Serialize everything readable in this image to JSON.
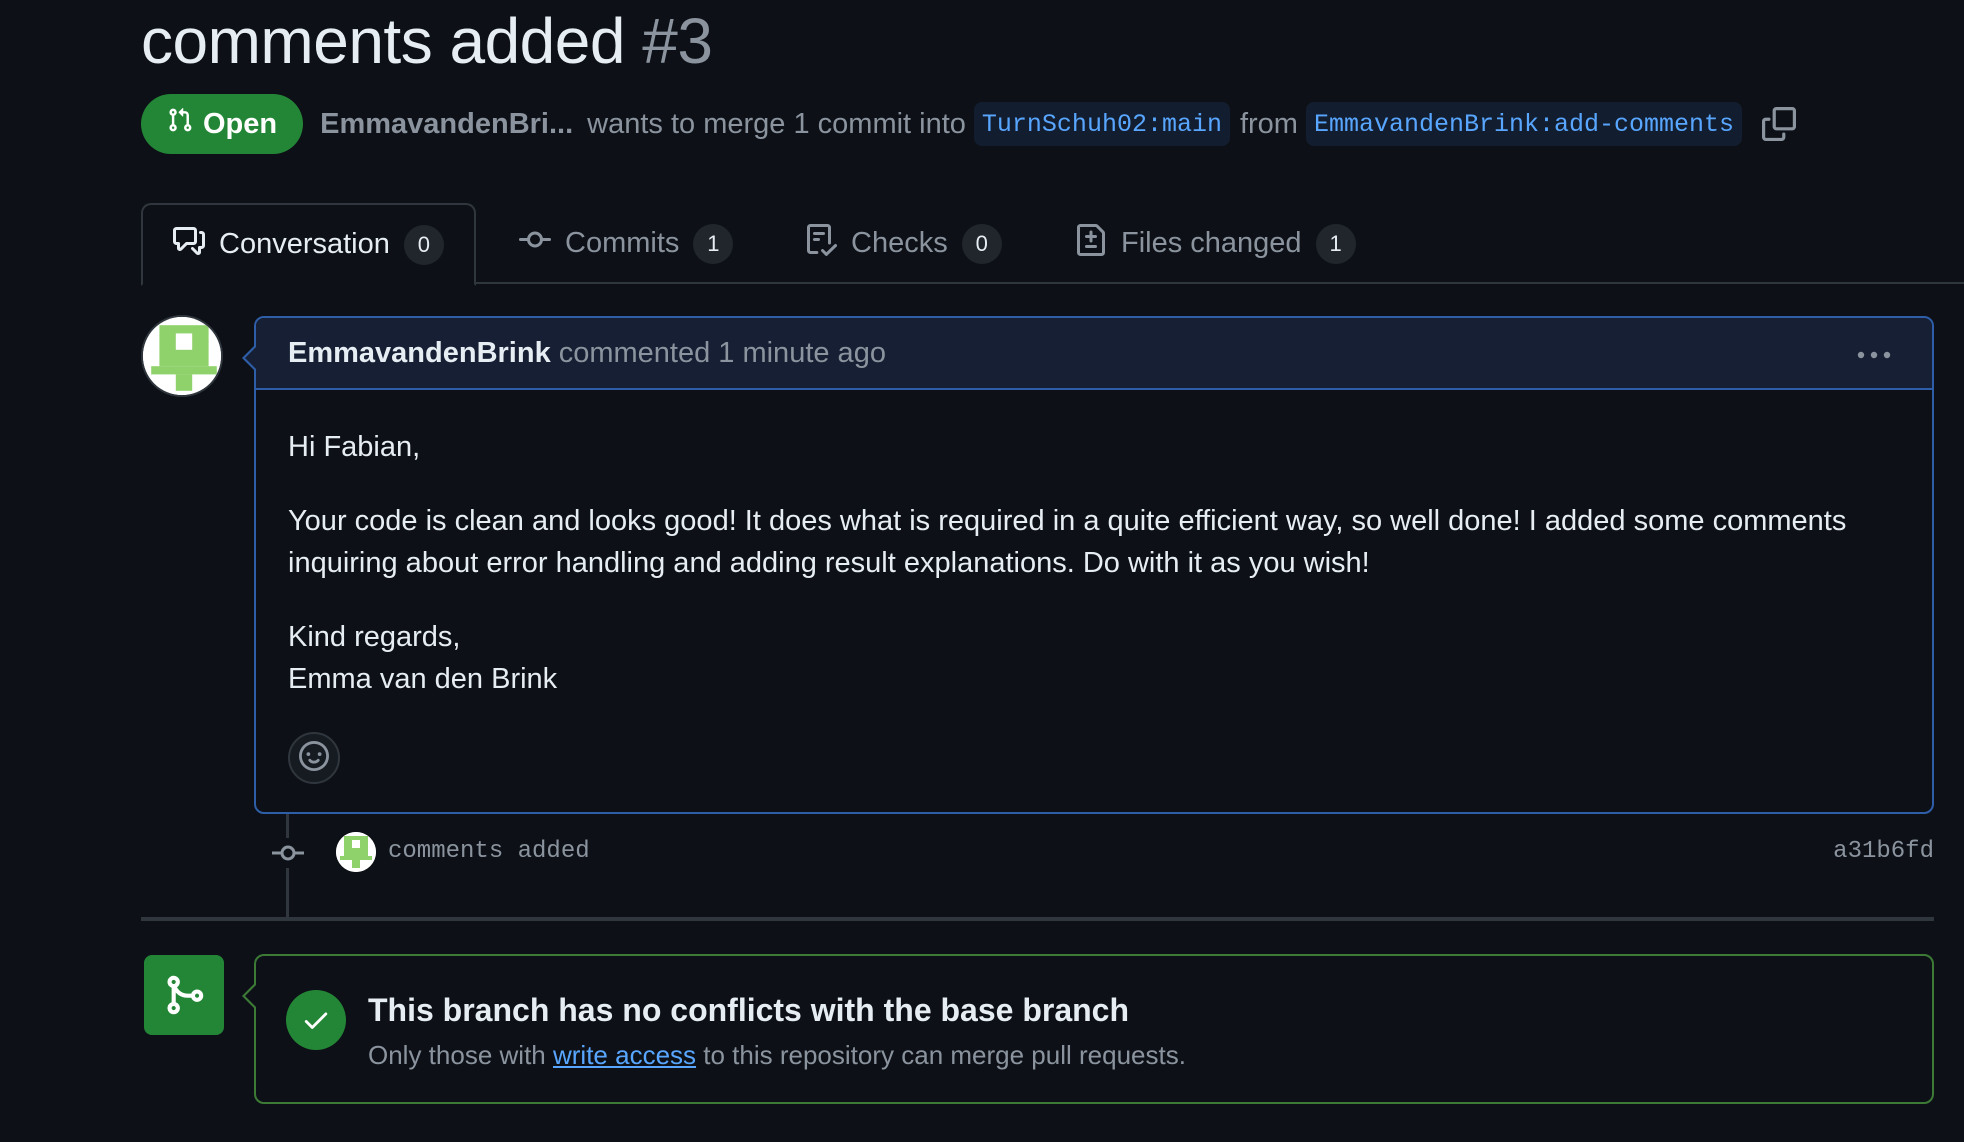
{
  "pr": {
    "title": "comments added",
    "number": "#3",
    "state": "Open",
    "author": "EmmavandenBri...",
    "merge_text": "wants to merge 1 commit into",
    "base_branch": "TurnSchuh02:main",
    "from_text": "from",
    "head_branch": "EmmavandenBrink:add-comments"
  },
  "tabs": [
    {
      "label": "Conversation",
      "count": "0"
    },
    {
      "label": "Commits",
      "count": "1"
    },
    {
      "label": "Checks",
      "count": "0"
    },
    {
      "label": "Files changed",
      "count": "1"
    }
  ],
  "comment": {
    "author": "EmmavandenBrink",
    "meta": "commented 1 minute ago",
    "greeting": "Hi Fabian,",
    "paragraph_line1": "Your code is clean and looks good! It does what is required in a quite efficient way, so well done! I added some comments",
    "paragraph_line2": "inquiring about error handling and adding result explanations. Do with it as you wish!",
    "sign_line1": "Kind regards,",
    "sign_line2": "Emma van den Brink"
  },
  "commit": {
    "message": "comments added",
    "sha": "a31b6fd"
  },
  "merge": {
    "title": "This branch has no conflicts with the base branch",
    "sub_before": "Only those with",
    "sub_link": "write access",
    "sub_after": "to this repository can merge pull requests."
  },
  "colors": {
    "background": "#0d1117",
    "open_green": "#238636",
    "link_blue": "#58a6ff",
    "comment_border": "#2f5ea8"
  }
}
